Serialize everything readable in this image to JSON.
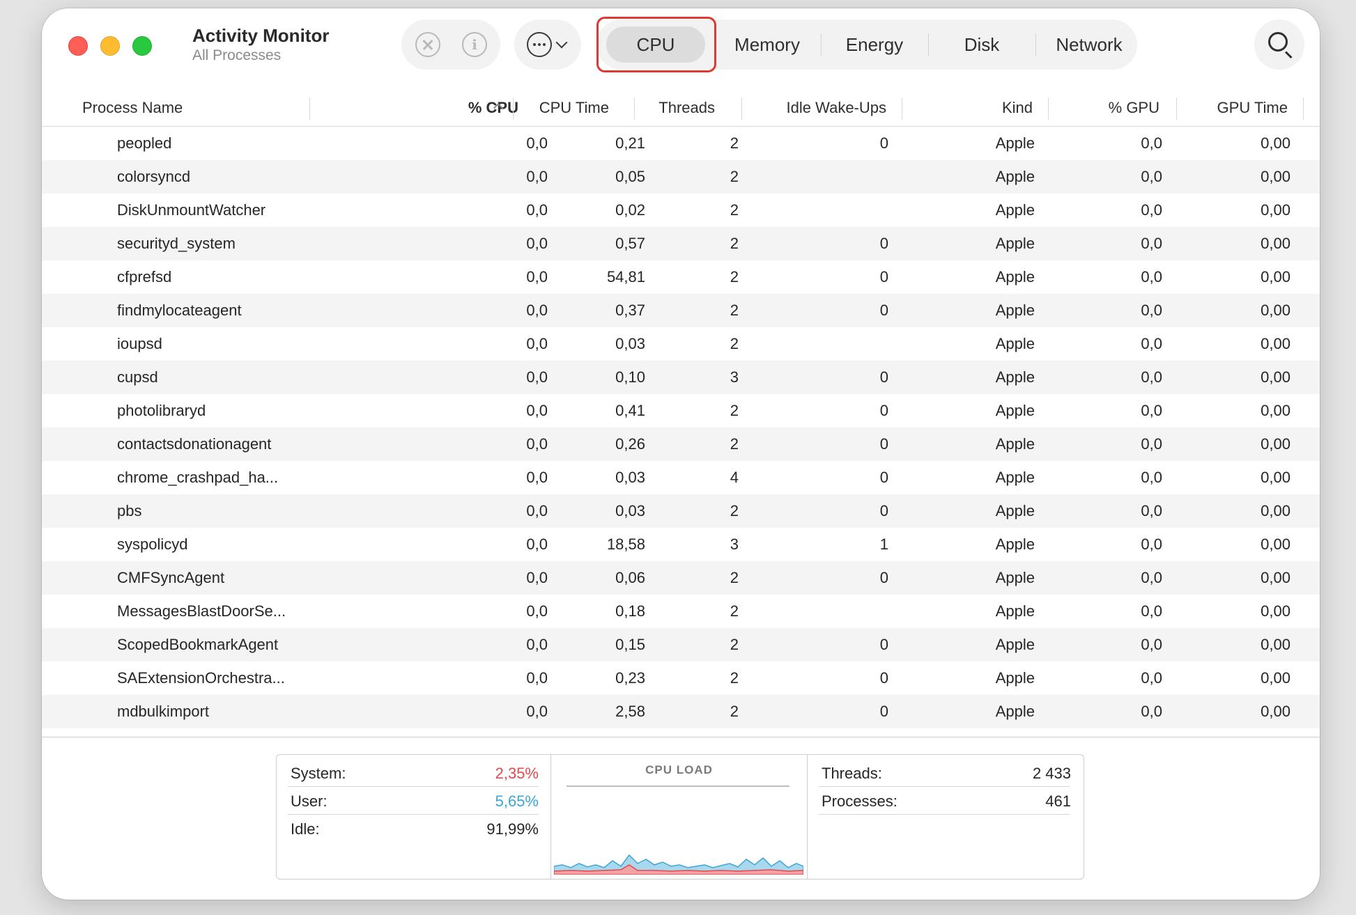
{
  "app": {
    "title": "Activity Monitor",
    "subtitle": "All Processes"
  },
  "toolbar": {
    "stop_icon": "x-circle-icon",
    "info_icon": "info-circle-icon",
    "more_icon": "ellipsis-circle-icon",
    "search_icon": "magnifier-icon",
    "tabs": [
      "CPU",
      "Memory",
      "Energy",
      "Disk",
      "Network"
    ],
    "active_tab": "CPU"
  },
  "columns": [
    "Process Name",
    "% CPU",
    "CPU Time",
    "Threads",
    "Idle Wake-Ups",
    "Kind",
    "% GPU",
    "GPU Time"
  ],
  "processes": [
    [
      "peopled",
      "0,0",
      "0,21",
      "2",
      "0",
      "Apple",
      "0,0",
      "0,00"
    ],
    [
      "colorsyncd",
      "0,0",
      "0,05",
      "2",
      "",
      "Apple",
      "0,0",
      "0,00"
    ],
    [
      "DiskUnmountWatcher",
      "0,0",
      "0,02",
      "2",
      "",
      "Apple",
      "0,0",
      "0,00"
    ],
    [
      "securityd_system",
      "0,0",
      "0,57",
      "2",
      "0",
      "Apple",
      "0,0",
      "0,00"
    ],
    [
      "cfprefsd",
      "0,0",
      "54,81",
      "2",
      "0",
      "Apple",
      "0,0",
      "0,00"
    ],
    [
      "findmylocateagent",
      "0,0",
      "0,37",
      "2",
      "0",
      "Apple",
      "0,0",
      "0,00"
    ],
    [
      "ioupsd",
      "0,0",
      "0,03",
      "2",
      "",
      "Apple",
      "0,0",
      "0,00"
    ],
    [
      "cupsd",
      "0,0",
      "0,10",
      "3",
      "0",
      "Apple",
      "0,0",
      "0,00"
    ],
    [
      "photolibraryd",
      "0,0",
      "0,41",
      "2",
      "0",
      "Apple",
      "0,0",
      "0,00"
    ],
    [
      "contactsdonationagent",
      "0,0",
      "0,26",
      "2",
      "0",
      "Apple",
      "0,0",
      "0,00"
    ],
    [
      "chrome_crashpad_ha...",
      "0,0",
      "0,03",
      "4",
      "0",
      "Apple",
      "0,0",
      "0,00"
    ],
    [
      "pbs",
      "0,0",
      "0,03",
      "2",
      "0",
      "Apple",
      "0,0",
      "0,00"
    ],
    [
      "syspolicyd",
      "0,0",
      "18,58",
      "3",
      "1",
      "Apple",
      "0,0",
      "0,00"
    ],
    [
      "CMFSyncAgent",
      "0,0",
      "0,06",
      "2",
      "0",
      "Apple",
      "0,0",
      "0,00"
    ],
    [
      "MessagesBlastDoorSe...",
      "0,0",
      "0,18",
      "2",
      "",
      "Apple",
      "0,0",
      "0,00"
    ],
    [
      "ScopedBookmarkAgent",
      "0,0",
      "0,15",
      "2",
      "0",
      "Apple",
      "0,0",
      "0,00"
    ],
    [
      "SAExtensionOrchestra...",
      "0,0",
      "0,23",
      "2",
      "0",
      "Apple",
      "0,0",
      "0,00"
    ],
    [
      "mdbulkimport",
      "0,0",
      "2,58",
      "2",
      "0",
      "Apple",
      "0,0",
      "0,00"
    ]
  ],
  "stats": {
    "system_label": "System:",
    "system_value": "2,35%",
    "user_label": "User:",
    "user_value": "5,65%",
    "idle_label": "Idle:",
    "idle_value": "91,99%",
    "cpu_load_title": "CPU LOAD",
    "threads_label": "Threads:",
    "threads_value": "2 433",
    "processes_label": "Processes:",
    "processes_value": "461"
  },
  "colors": {
    "system": "#e5484d",
    "user": "#3aa6d8",
    "highlight": "#e0392f"
  }
}
